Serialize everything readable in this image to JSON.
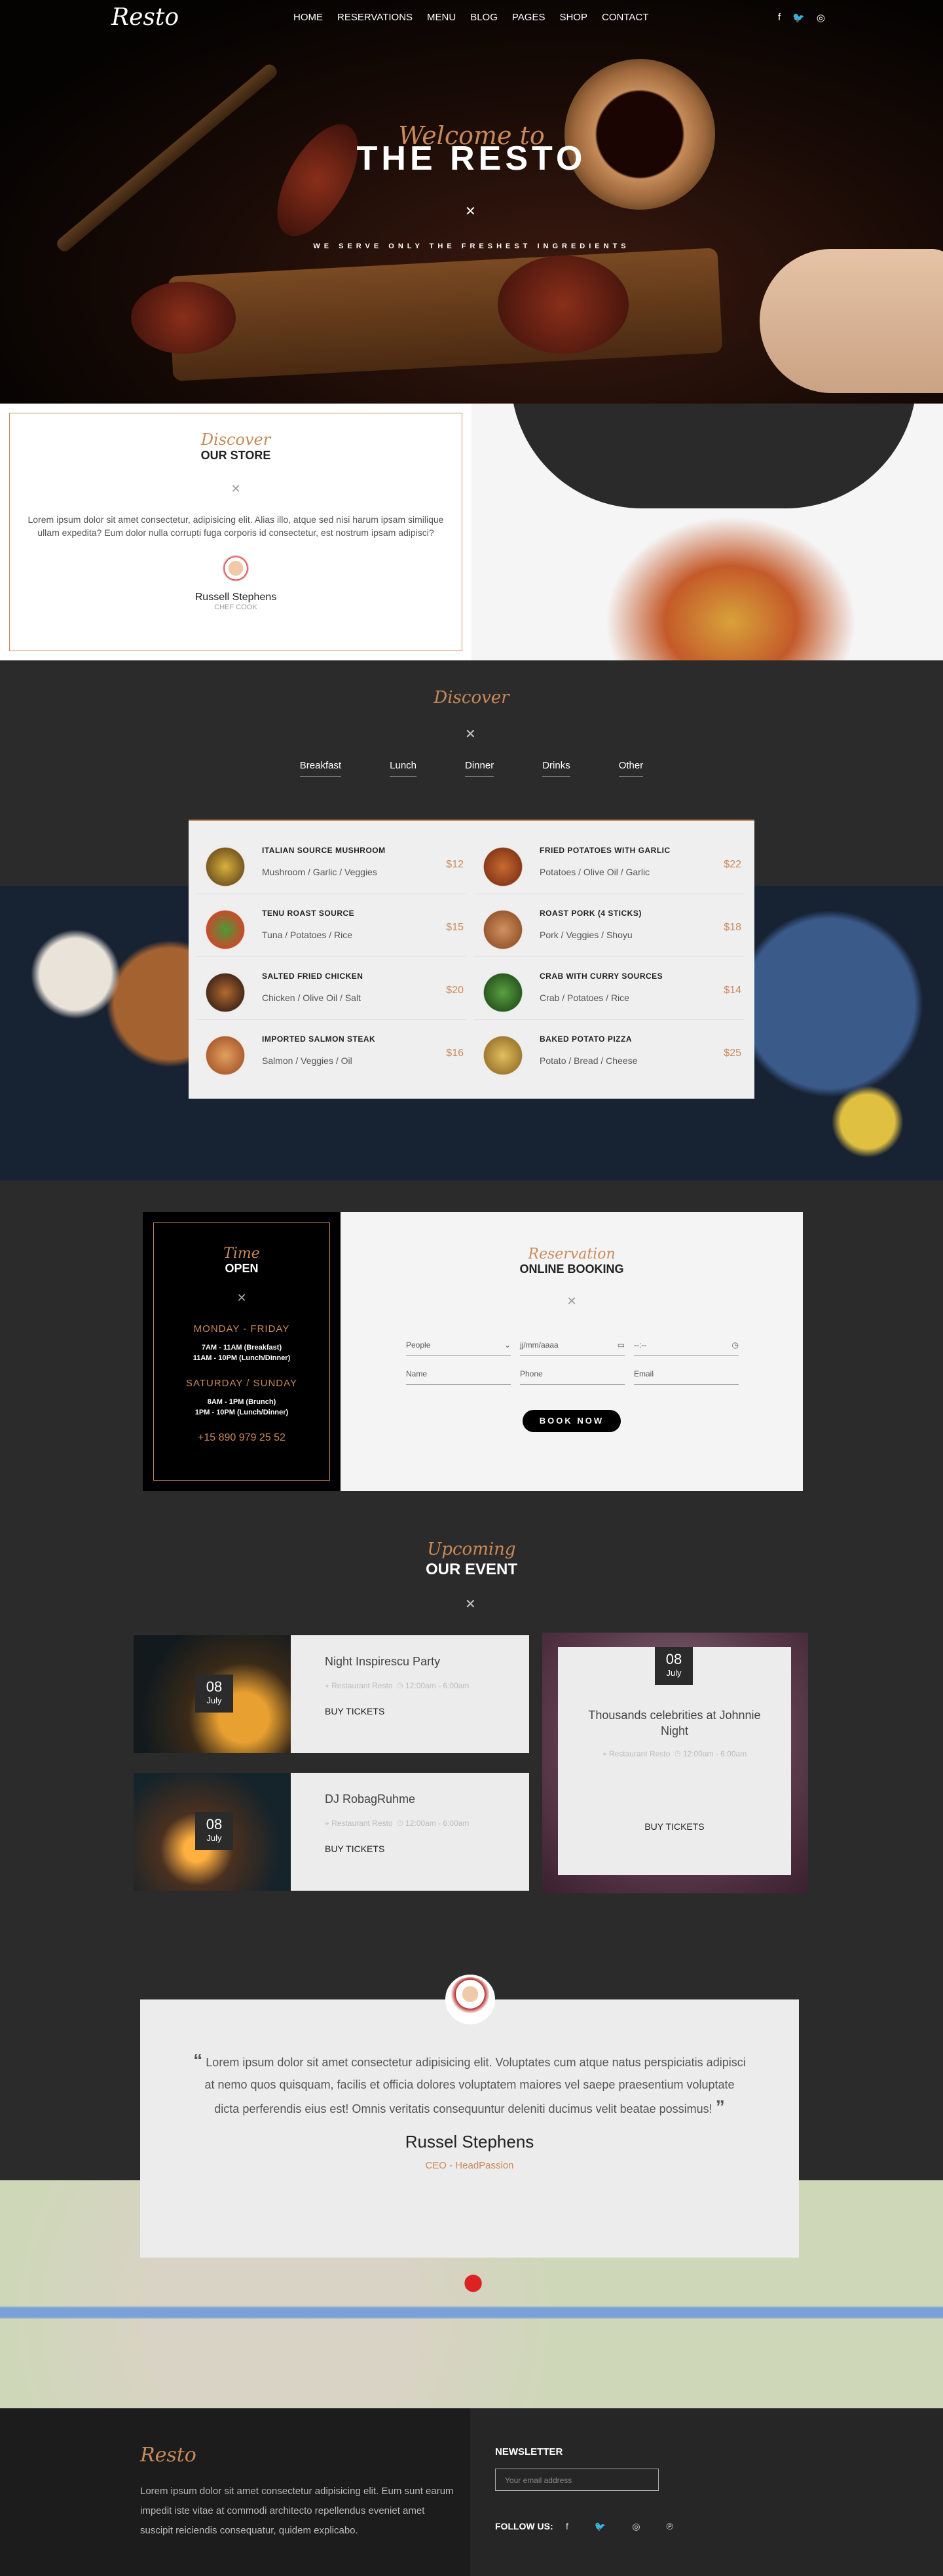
{
  "nav": {
    "logo": "Resto",
    "items": [
      "HOME",
      "RESERVATIONS",
      "MENU",
      "BLOG",
      "PAGES",
      "SHOP",
      "CONTACT"
    ],
    "social_icons": [
      "facebook-icon",
      "twitter-icon",
      "instagram-icon"
    ]
  },
  "hero": {
    "welcome": "Welcome to",
    "title": "THE RESTO",
    "subtitle": "WE SERVE ONLY THE FRESHEST INGREDIENTS"
  },
  "store": {
    "script": "Discover",
    "title": "OUR STORE",
    "text": "Lorem ipsum dolor sit amet consectetur, adipisicing elit. Alias illo, atque sed nisi harum ipsam similique ullam expedita? Eum dolor nulla corrupti fuga corporis id consectetur, est nostrum ipsam adipisci?",
    "chef_name": "Russell Stephens",
    "chef_role": "CHEF COOK"
  },
  "discover": {
    "script": "Discover",
    "tabs": [
      "Breakfast",
      "Lunch",
      "Dinner",
      "Drinks",
      "Other"
    ],
    "items": [
      {
        "name": "ITALIAN SOURCE MUSHROOM",
        "desc": "Mushroom / Garlic / Veggies",
        "price": "$12"
      },
      {
        "name": "FRIED POTATOES WITH GARLIC",
        "desc": "Potatoes / Olive Oil / Garlic",
        "price": "$22"
      },
      {
        "name": "TENU ROAST SOURCE",
        "desc": "Tuna / Potatoes / Rice",
        "price": "$15"
      },
      {
        "name": "ROAST PORK (4 STICKS)",
        "desc": "Pork / Veggies / Shoyu",
        "price": "$18"
      },
      {
        "name": "SALTED FRIED CHICKEN",
        "desc": "Chicken / Olive Oil / Salt",
        "price": "$20"
      },
      {
        "name": "CRAB WITH CURRY SOURCES",
        "desc": "Crab / Potatoes / Rice",
        "price": "$14"
      },
      {
        "name": "IMPORTED SALMON STEAK",
        "desc": "Salmon / Veggies / Oil",
        "price": "$16"
      },
      {
        "name": "BAKED POTATO PIZZA",
        "desc": "Potato / Bread / Cheese",
        "price": "$25"
      }
    ]
  },
  "hours": {
    "script": "Time",
    "title": "OPEN",
    "weekday_label": "MONDAY - FRIDAY",
    "weekday_line1": "7AM - 11AM (Breakfast)",
    "weekday_line2": "11AM - 10PM (Lunch/Dinner)",
    "weekend_label": "SATURDAY / SUNDAY",
    "weekend_line1": "8AM - 1PM (Brunch)",
    "weekend_line2": "1PM - 10PM (Lunch/Dinner)",
    "phone": "+15 890 979 25 52"
  },
  "reservation": {
    "script": "Reservation",
    "title": "ONLINE BOOKING",
    "people_value": "People",
    "date_placeholder": "jj/mm/aaaa",
    "time_placeholder": "--:--",
    "name_placeholder": "Name",
    "phone_placeholder": "Phone",
    "email_placeholder": "Email",
    "button": "BOOK NOW"
  },
  "events": {
    "script": "Upcoming",
    "title": "OUR EVENT",
    "list": [
      {
        "day": "08",
        "month": "July",
        "title": "Night Inspirescu Party",
        "place": "Restaurant Resto",
        "time": "12:00am - 6:00am",
        "buy": "BUY TICKETS"
      },
      {
        "day": "08",
        "month": "July",
        "title": "DJ RobagRuhme",
        "place": "Restaurant Resto",
        "time": "12:00am - 6:00am",
        "buy": "BUY TICKETS"
      },
      {
        "day": "08",
        "month": "July",
        "title": "Thousands celebrities at Johnnie Night",
        "place": "Restaurant Resto",
        "time": "12:00am - 6:00am",
        "buy": "BUY TICKETS"
      }
    ]
  },
  "testimonial": {
    "quote": "Lorem ipsum dolor sit amet consectetur adipisicing elit. Voluptates cum atque natus perspiciatis adipisci at nemo quos quisquam, facilis et officia dolores voluptatem maiores vel saepe praesentium voluptate dicta perferendis eius est! Omnis veritatis consequuntur deleniti ducimus velit beatae possimus!",
    "name": "Russel Stephens",
    "role": "CEO - HeadPassion"
  },
  "footer": {
    "logo": "Resto",
    "text": "Lorem ipsum dolor sit amet consectetur adipisicing elit. Eum sunt earum impedit iste vitae at commodi architecto repellendus eveniet amet suscipit reiciendis consequatur, quidem explicabo.",
    "newsletter_title": "NEWSLETTER",
    "email_placeholder": "Your email address",
    "follow_label": "FOLLOW US:",
    "social_icons": [
      "facebook-icon",
      "twitter-icon",
      "instagram-icon",
      "pinterest-icon"
    ]
  }
}
